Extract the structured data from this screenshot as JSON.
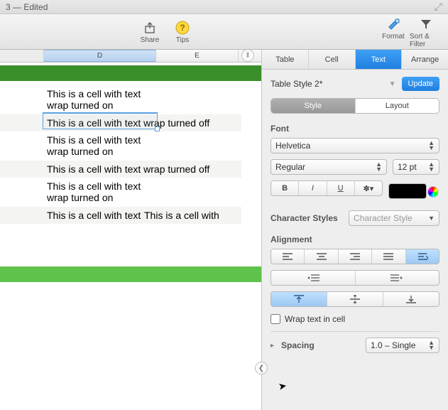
{
  "window": {
    "title": "3 — Edited"
  },
  "toolbar": {
    "share": "Share",
    "tips": "Tips",
    "format": "Format",
    "sort": "Sort & Filter"
  },
  "columns": {
    "d": "D",
    "e": "E"
  },
  "cells": {
    "r1": "This is a cell with text wrap turned on",
    "r2": "This is a cell with text wrap turned off",
    "r3": "This is a cell with text wrap turned on",
    "r4": "This is a cell with text wrap turned off",
    "r5": "This is a cell with text wrap turned on",
    "r6a": "This is a cell with text",
    "r6b": "This is a cell with"
  },
  "inspector": {
    "tabs": {
      "table": "Table",
      "cell": "Cell",
      "text": "Text",
      "arrange": "Arrange"
    },
    "style_name": "Table Style 2*",
    "update": "Update",
    "seg": {
      "style": "Style",
      "layout": "Layout"
    },
    "font_label": "Font",
    "font_family": "Helvetica",
    "font_weight": "Regular",
    "font_size": "12 pt",
    "b": "B",
    "i": "I",
    "u": "U",
    "gear": "✻",
    "char_label": "Character Styles",
    "char_value": "Character Style",
    "align_label": "Alignment",
    "wrap_label": "Wrap text in cell",
    "spacing_label": "Spacing",
    "spacing_value": "1.0 – Single"
  }
}
